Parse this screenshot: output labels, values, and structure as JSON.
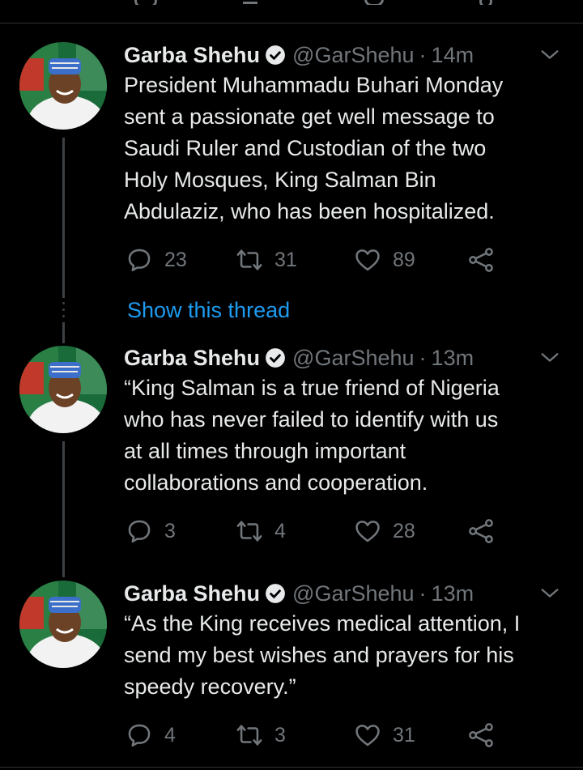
{
  "colors": {
    "background": "#000000",
    "text": "#e7e9ea",
    "muted": "#71767b",
    "accent": "#1d9bf0",
    "divider": "#2f3336"
  },
  "tweets": [
    {
      "name": "Garba Shehu",
      "handle": "@GarShehu",
      "separator": "·",
      "time": "14m",
      "text": "President Muhammadu Buhari Monday\nsent a passionate get well message to\nSaudi Ruler and Custodian of the two\nHoly Mosques, King Salman Bin\nAbdulaziz, who has been hospitalized.",
      "replies": "23",
      "retweets": "31",
      "likes": "89"
    },
    {
      "name": "Garba Shehu",
      "handle": "@GarShehu",
      "separator": "·",
      "time": "13m",
      "text": "“King Salman is a true friend of Nigeria\nwho has never failed to identify with us\nat all times through important\ncollaborations and cooperation.",
      "replies": "3",
      "retweets": "4",
      "likes": "28"
    },
    {
      "name": "Garba Shehu",
      "handle": "@GarShehu",
      "separator": "·",
      "time": "13m",
      "text": "“As the King receives medical attention, I\nsend my best wishes and prayers for his\nspeedy recovery.”",
      "replies": "4",
      "retweets": "3",
      "likes": "31"
    }
  ],
  "show_thread": "Show this thread",
  "icons": {
    "verified": "verified-badge-icon",
    "caret": "chevron-down-icon",
    "reply": "reply-icon",
    "retweet": "retweet-icon",
    "like": "heart-icon",
    "share": "share-icon",
    "avatar": "profile-photo"
  }
}
